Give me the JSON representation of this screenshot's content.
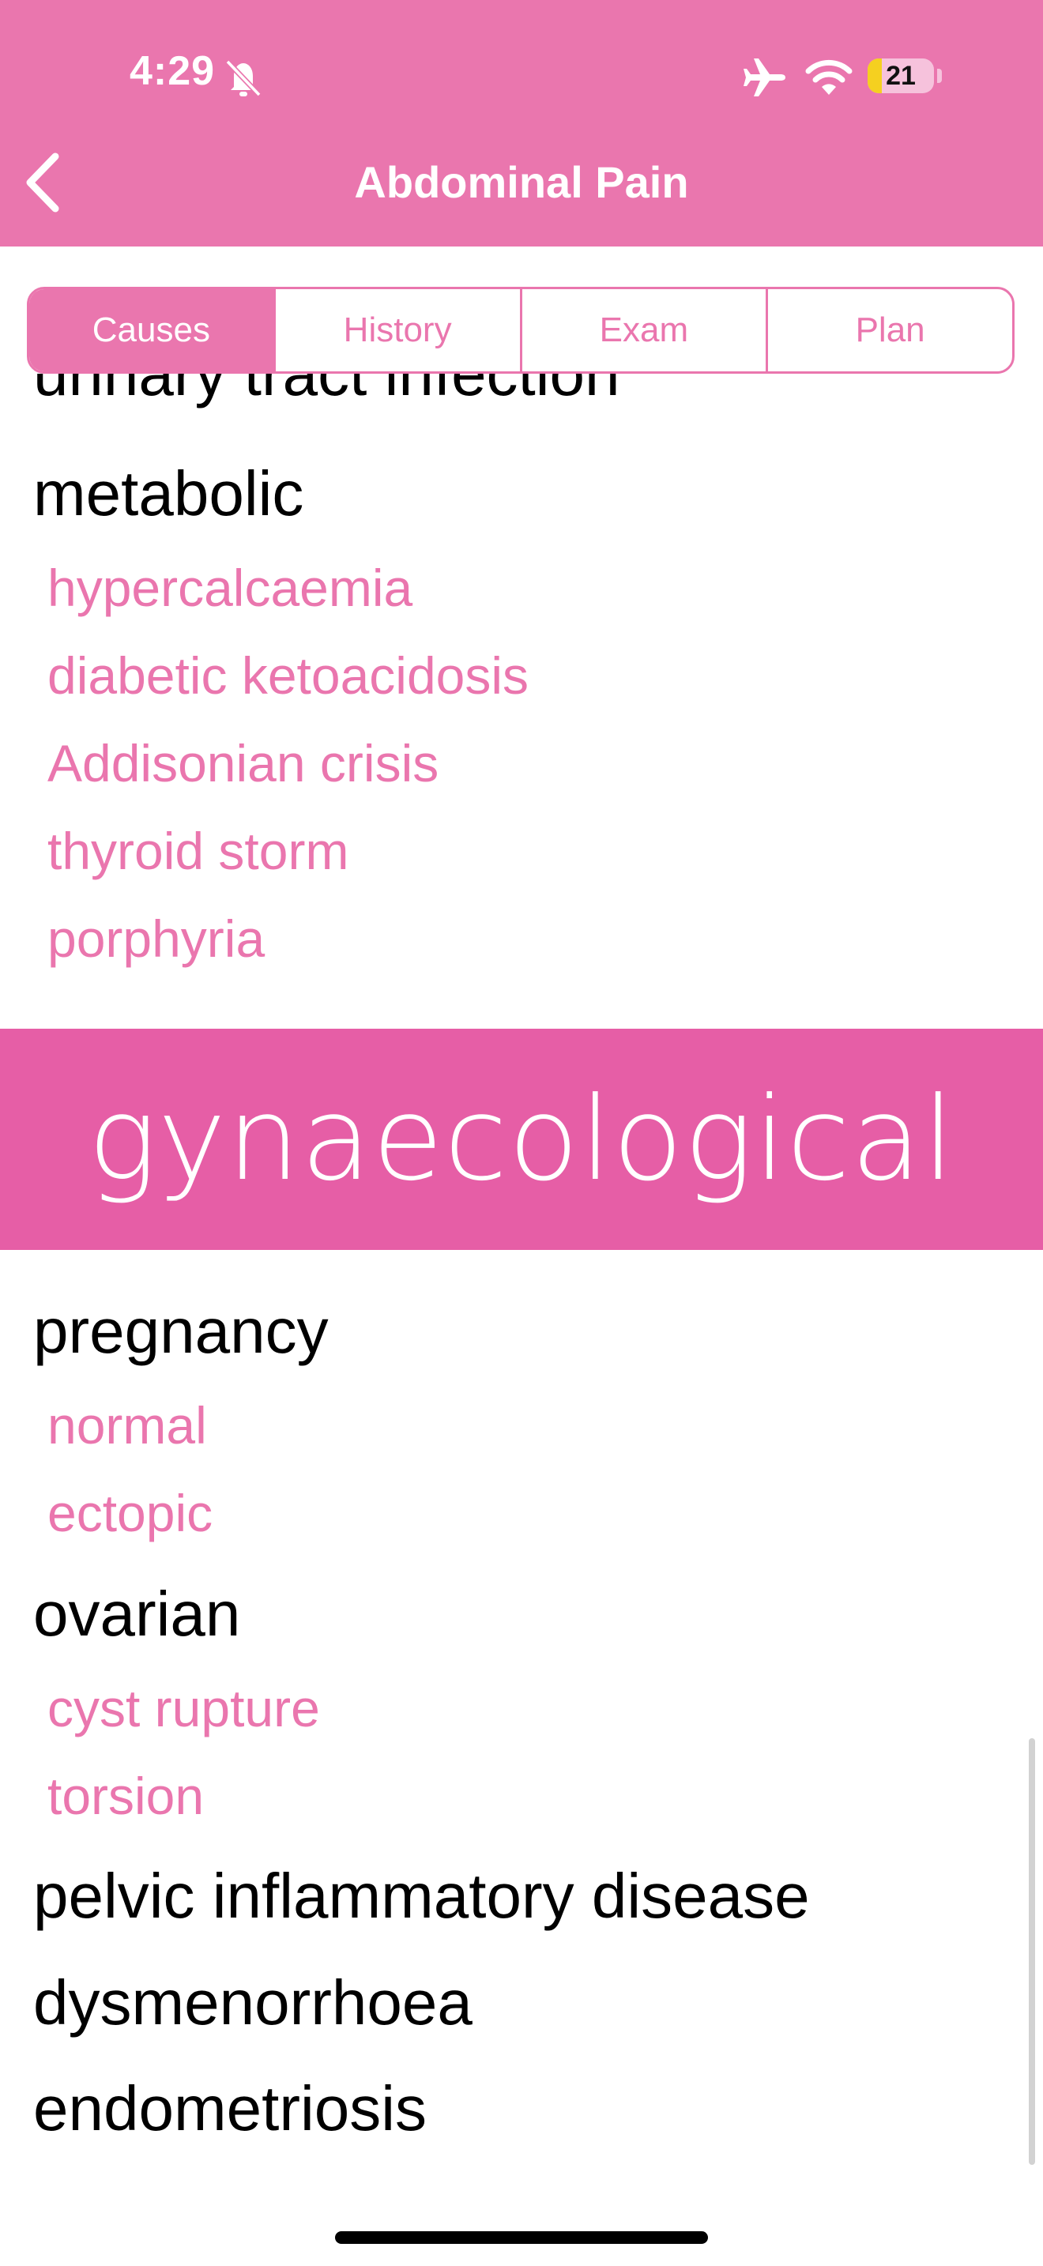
{
  "status_bar": {
    "time": "4:29",
    "battery_level": "21",
    "battery_fraction": 0.21,
    "icons": [
      "bell-slash-icon",
      "airplane-icon",
      "wifi-icon",
      "battery-icon"
    ]
  },
  "nav": {
    "title": "Abdominal Pain",
    "back_icon": "chevron-left-icon"
  },
  "tabs": [
    {
      "label": "Causes",
      "active": true
    },
    {
      "label": "History",
      "active": false
    },
    {
      "label": "Exam",
      "active": false
    },
    {
      "label": "Plan",
      "active": false
    }
  ],
  "content": {
    "cut_off_heading": "urinary tract infection",
    "metabolic": {
      "heading": "metabolic",
      "items": [
        "hypercalcaemia",
        "diabetic ketoacidosis",
        "Addisonian crisis",
        "thyroid storm",
        "porphyria"
      ]
    },
    "section_banner": "gynaecological",
    "pregnancy": {
      "heading": "pregnancy",
      "items": [
        "normal",
        "ectopic"
      ]
    },
    "ovarian": {
      "heading": "ovarian",
      "items": [
        "cyst rupture",
        "torsion"
      ]
    },
    "other_headings": [
      "pelvic inflammatory disease",
      "dysmenorrhoea",
      "endometriosis"
    ]
  },
  "colors": {
    "header": "#ea76ae",
    "banner": "#e65ea6",
    "link": "#ea76ae",
    "text": "#000000"
  }
}
